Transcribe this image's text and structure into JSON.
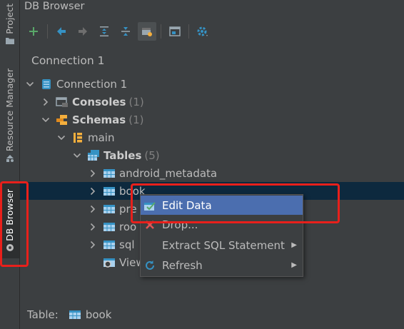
{
  "sidebar": {
    "project_label": "Project",
    "resource_label": "Resource Manager",
    "db_label": "DB Browser"
  },
  "window": {
    "title": "DB Browser"
  },
  "toolbar_icons": [
    "add-icon",
    "back-icon",
    "forward-icon",
    "expand-all-icon",
    "collapse-all-icon",
    "filter-icon",
    "open-console-icon",
    "settings-icon"
  ],
  "connection_tab": "Connection 1",
  "tree": {
    "connection": "Connection 1",
    "consoles": {
      "label": "Consoles",
      "count": "(1)"
    },
    "schemas": {
      "label": "Schemas",
      "count": "(1)"
    },
    "main": "main",
    "tables": {
      "label": "Tables",
      "count": "(5)"
    },
    "items": [
      "android_metadata",
      "book",
      "pre",
      "roo",
      "sql"
    ],
    "views": "Views"
  },
  "context_menu": {
    "edit_data": "Edit Data",
    "drop": "Drop...",
    "extract_sql": "Extract SQL Statement",
    "refresh": "Refresh"
  },
  "status": {
    "label": "Table:",
    "value": "book"
  },
  "colors": {
    "background": "#3c3f41",
    "selection": "#0d293e",
    "menu_highlight": "#4b6eaf",
    "annotation": "#e8201b"
  }
}
